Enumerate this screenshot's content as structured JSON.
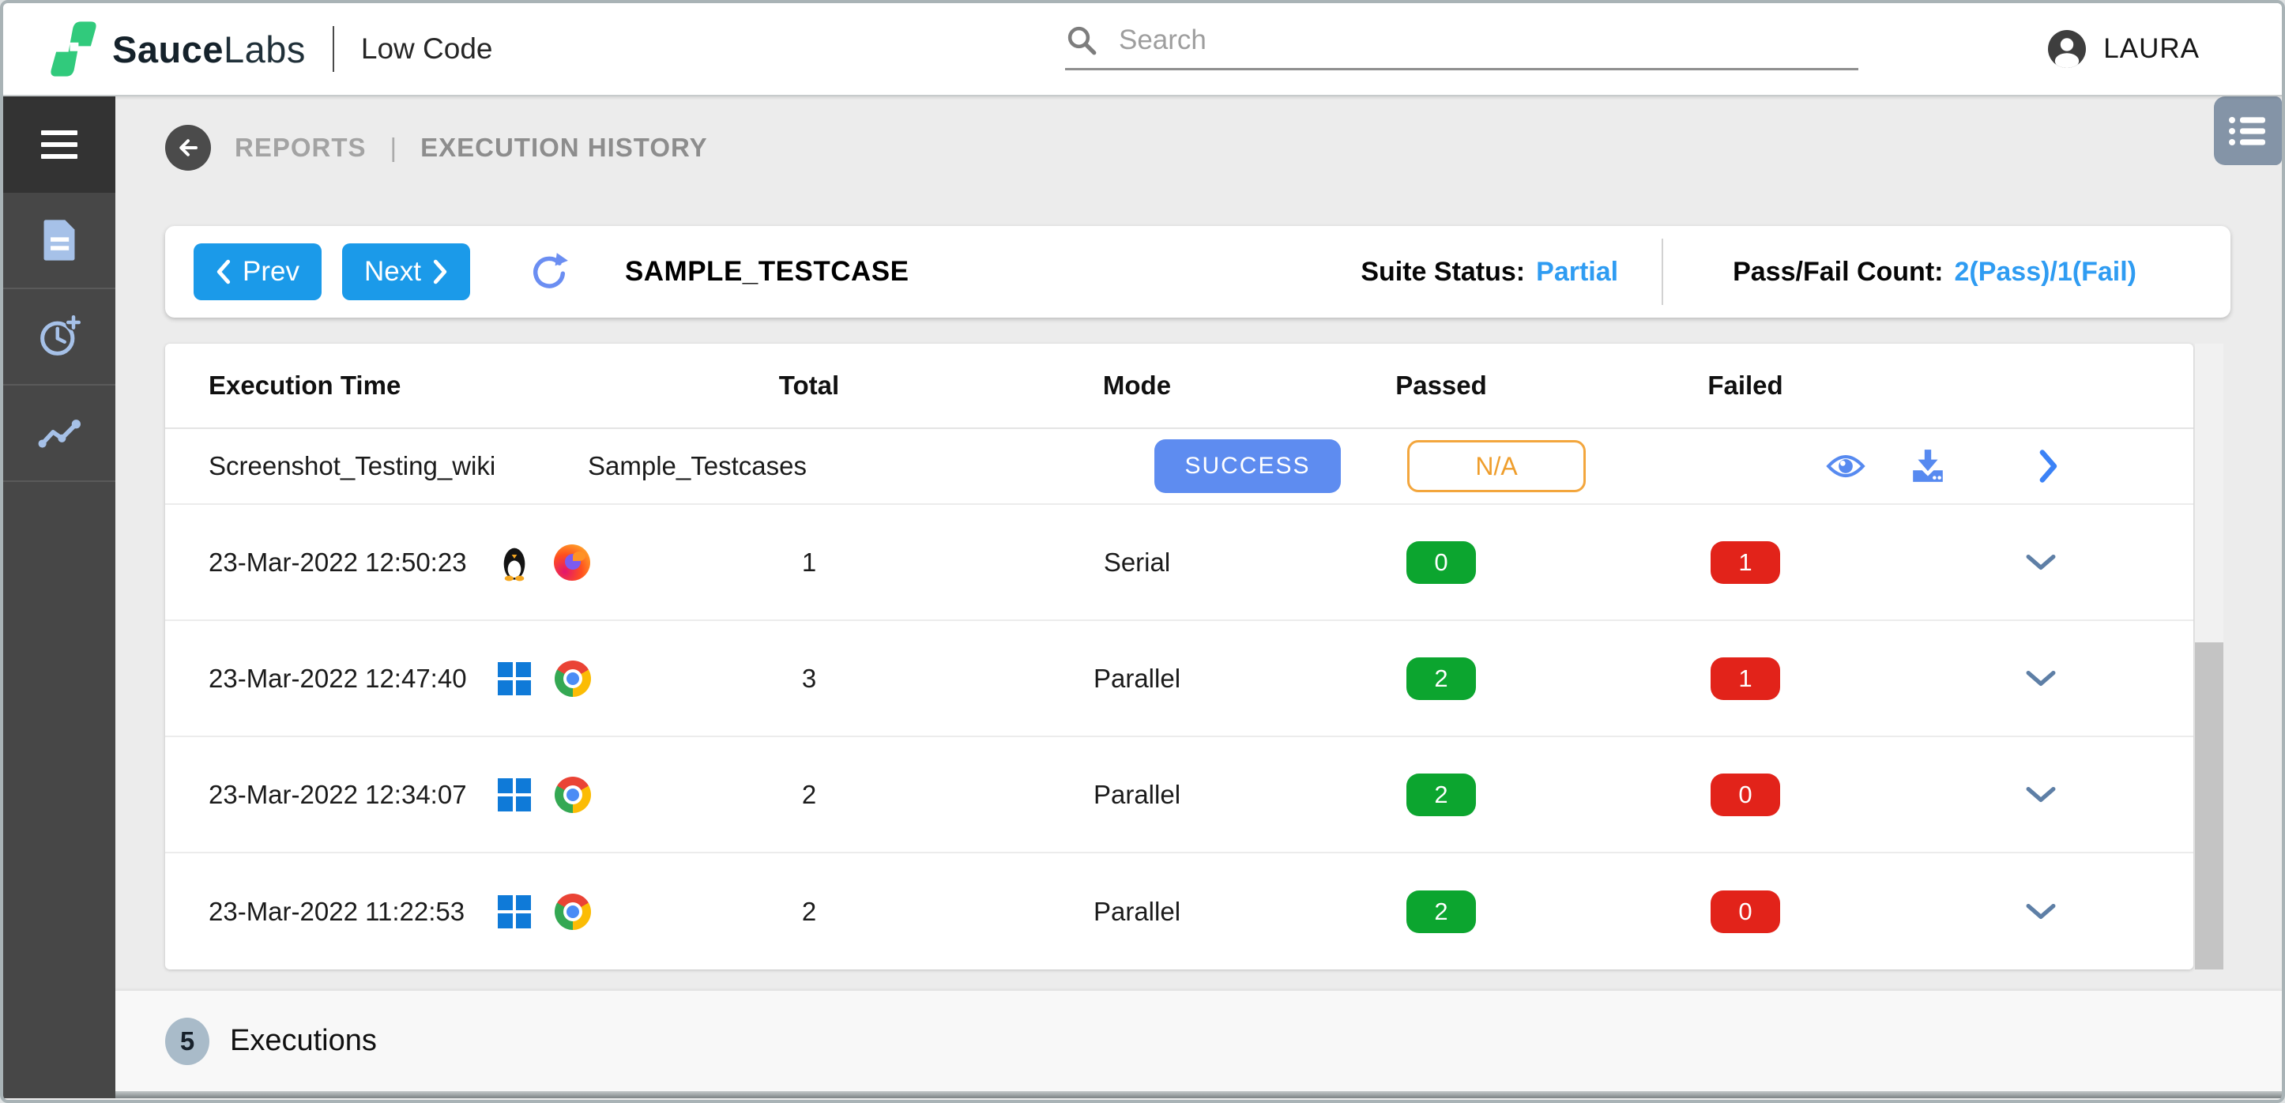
{
  "topbar": {
    "brand_bold": "Sauce",
    "brand_light": "Labs",
    "product": "Low Code",
    "search_placeholder": "Search",
    "username": "LAURA"
  },
  "sidebar": {
    "items": [
      {
        "name": "menu",
        "icon": "hamburger-icon"
      },
      {
        "name": "reports",
        "icon": "document-icon"
      },
      {
        "name": "schedule",
        "icon": "clock-plus-icon"
      },
      {
        "name": "trends",
        "icon": "trend-line-icon"
      }
    ]
  },
  "breadcrumb": {
    "section": "REPORTS",
    "separator": "|",
    "current": "EXECUTION HISTORY"
  },
  "toolbar": {
    "prev_label": "Prev",
    "next_label": "Next",
    "testcase_name": "SAMPLE_TESTCASE",
    "suite_status_label": "Suite Status:",
    "suite_status_value": "Partial",
    "pass_fail_label": "Pass/Fail Count:",
    "pass_fail_value": "2(Pass)/1(Fail)"
  },
  "table": {
    "headers": {
      "execution_time": "Execution Time",
      "total": "Total",
      "mode": "Mode",
      "passed": "Passed",
      "failed": "Failed"
    },
    "summary_row": {
      "name": "Screenshot_Testing_wiki",
      "suite": "Sample_Testcases",
      "status_badge": "SUCCESS",
      "passed_badge": "N/A"
    },
    "rows": [
      {
        "time": "23-Mar-2022 12:50:23",
        "os": "linux",
        "browser": "firefox",
        "total": "1",
        "mode": "Serial",
        "passed": "0",
        "failed": "1"
      },
      {
        "time": "23-Mar-2022 12:47:40",
        "os": "windows",
        "browser": "chrome",
        "total": "3",
        "mode": "Parallel",
        "passed": "2",
        "failed": "1"
      },
      {
        "time": "23-Mar-2022 12:34:07",
        "os": "windows",
        "browser": "chrome",
        "total": "2",
        "mode": "Parallel",
        "passed": "2",
        "failed": "0"
      },
      {
        "time": "23-Mar-2022 11:22:53",
        "os": "windows",
        "browser": "chrome",
        "total": "2",
        "mode": "Parallel",
        "passed": "2",
        "failed": "0"
      }
    ]
  },
  "footer": {
    "count": "5",
    "label": "Executions"
  },
  "colors": {
    "primary_blue": "#1b9ae9",
    "link_blue": "#2f9cf2",
    "success_badge_blue": "#5e8cf0",
    "warning_orange": "#f3a63d",
    "pass_green": "#0ca52f",
    "fail_red": "#e2231a",
    "action_icon_blue": "#578af0",
    "sidebar_icon_blue": "#a6c1e8",
    "brand_green": "#31ca7c"
  }
}
